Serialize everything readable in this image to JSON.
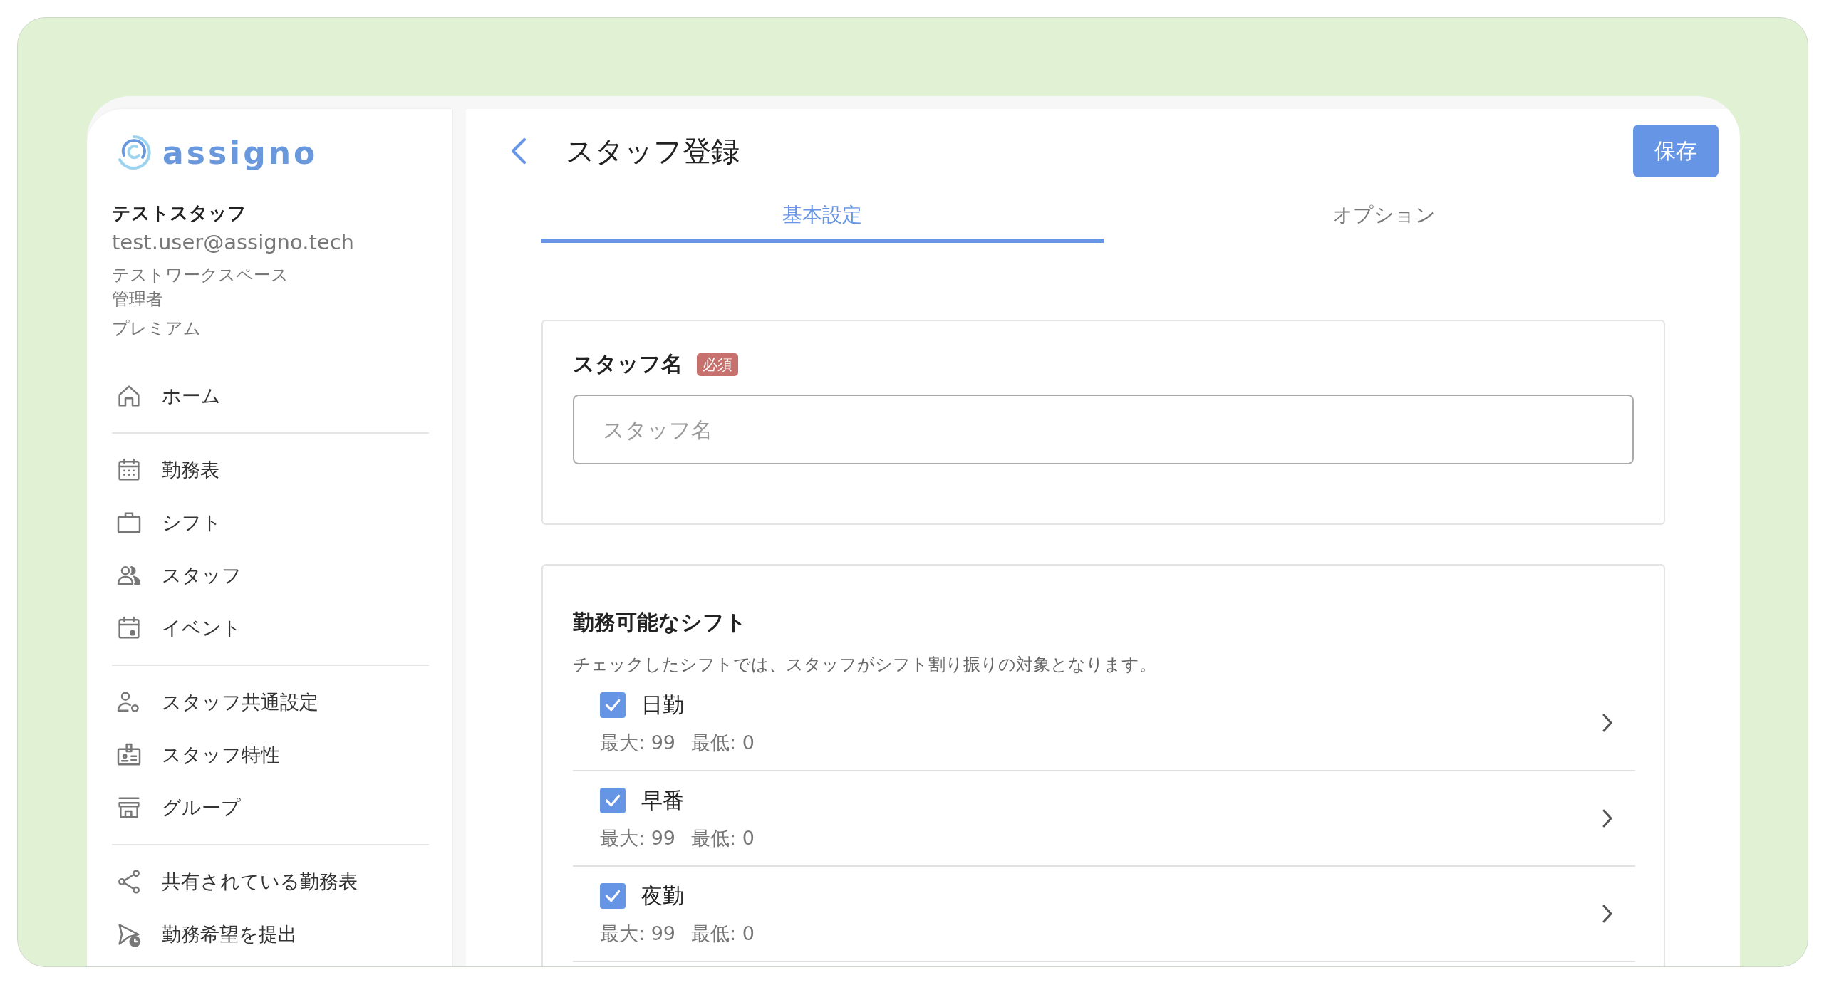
{
  "logo": {
    "text": "assigno"
  },
  "user": {
    "name": "テストスタッフ",
    "email": "test.user@assigno.tech",
    "workspace": "テストワークスペース",
    "role": "管理者",
    "plan": "プレミアム"
  },
  "nav_sections": [
    {
      "items": [
        {
          "label": "ホーム",
          "kind": "home"
        }
      ]
    },
    {
      "items": [
        {
          "label": "勤務表",
          "kind": "calendar"
        },
        {
          "label": "シフト",
          "kind": "briefcase"
        },
        {
          "label": "スタッフ",
          "kind": "people"
        },
        {
          "label": "イベント",
          "kind": "event"
        }
      ]
    },
    {
      "items": [
        {
          "label": "スタッフ共通設定",
          "kind": "person-gear"
        },
        {
          "label": "スタッフ特性",
          "kind": "badge"
        },
        {
          "label": "グループ",
          "kind": "store"
        }
      ]
    },
    {
      "items": [
        {
          "label": "共有されている勤務表",
          "kind": "share"
        },
        {
          "label": "勤務希望を提出",
          "kind": "send-clock"
        }
      ]
    }
  ],
  "header": {
    "title": "スタッフ登録",
    "save_button": "保存"
  },
  "tabs": [
    {
      "label": "基本設定",
      "selected": true
    },
    {
      "label": "オプション",
      "selected": false
    }
  ],
  "staff_name": {
    "label": "スタッフ名",
    "badge": "必須",
    "placeholder": "スタッフ名"
  },
  "shifts": {
    "title": "勤務可能なシフト",
    "description": "チェックしたシフトでは、スタッフがシフト割り振りの対象となります。",
    "items": [
      {
        "name": "日勤",
        "checked": true,
        "max": "最大: 99",
        "min": "最低: 0"
      },
      {
        "name": "早番",
        "checked": true,
        "max": "最大: 99",
        "min": "最低: 0"
      },
      {
        "name": "夜勤",
        "checked": true,
        "max": "最大: 99",
        "min": "最低: 0"
      }
    ]
  }
}
